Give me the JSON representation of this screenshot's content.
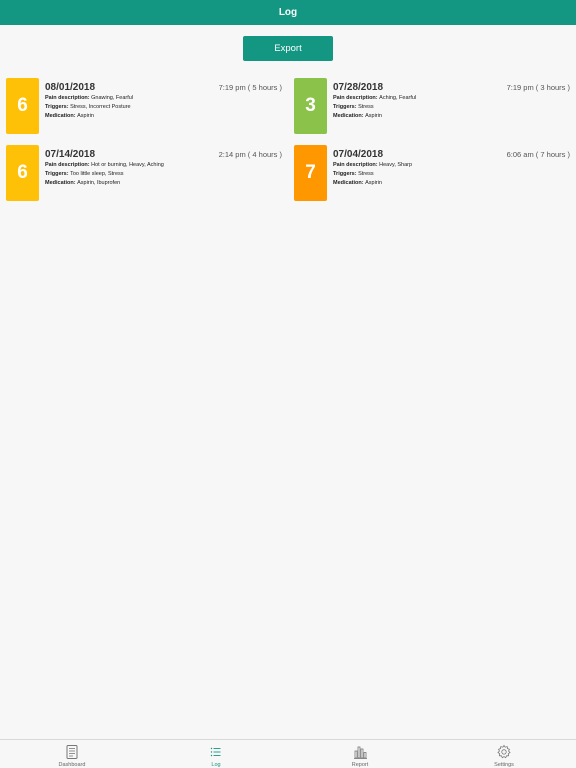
{
  "header": {
    "title": "Log"
  },
  "toolbar": {
    "export_label": "Export"
  },
  "labels": {
    "pain": "Pain description: ",
    "triggers": "Triggers: ",
    "medication": "Medication: "
  },
  "colors": {
    "brand": "#139783",
    "yellow": "#ffc107",
    "green": "#8bc34a",
    "orange": "#ff9800"
  },
  "entries": [
    {
      "score": "6",
      "date": "08/01/2018",
      "time": "7:19 pm ( 5 hours )",
      "pain": "Gnawing, Fearful",
      "triggers": "Stress, Incorrect Posture",
      "medication": "Aspirin",
      "color": "#ffc107"
    },
    {
      "score": "3",
      "date": "07/28/2018",
      "time": "7:19 pm ( 3 hours )",
      "pain": "Aching, Fearful",
      "triggers": "Stress",
      "medication": "Aspirin",
      "color": "#8bc34a"
    },
    {
      "score": "6",
      "date": "07/14/2018",
      "time": "2:14 pm ( 4 hours )",
      "pain": "Hot or burning, Heavy, Aching",
      "triggers": "Too little sleep, Stress",
      "medication": "Aspirin, Ibuprofen",
      "color": "#ffc107"
    },
    {
      "score": "7",
      "date": "07/04/2018",
      "time": "6:06 am ( 7 hours )",
      "pain": "Heavy, Sharp",
      "triggers": "Stress",
      "medication": "Aspirin",
      "color": "#ff9800"
    }
  ],
  "tabs": [
    {
      "label": "Dashboard",
      "icon": "dashboard-icon",
      "active": false
    },
    {
      "label": "Log",
      "icon": "list-icon",
      "active": true
    },
    {
      "label": "Report",
      "icon": "bar-chart-icon",
      "active": false
    },
    {
      "label": "Settings",
      "icon": "gear-icon",
      "active": false
    }
  ]
}
